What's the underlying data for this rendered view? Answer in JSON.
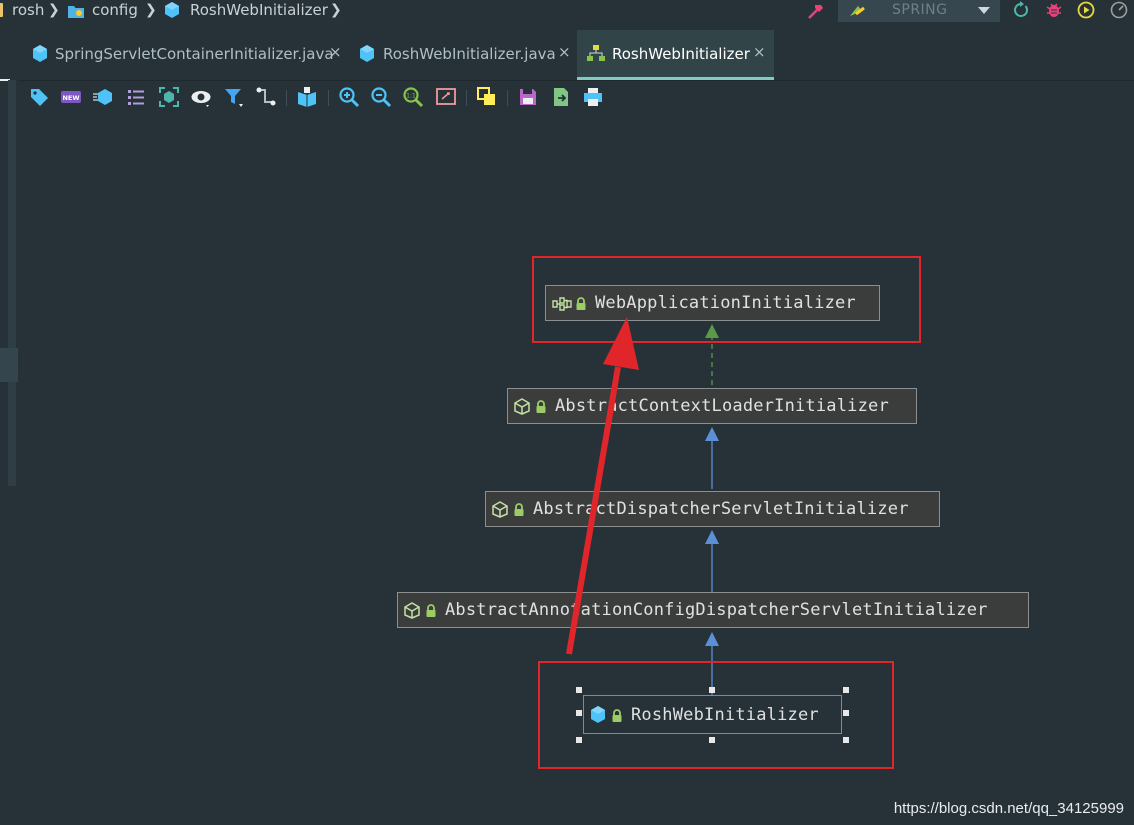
{
  "navbar": {
    "breadcrumbs": [
      {
        "label": "rosh",
        "icon": "module-icon"
      },
      {
        "label": "config",
        "icon": "package-icon"
      },
      {
        "label": "RoshWebInitializer",
        "icon": "class-icon"
      }
    ],
    "run_config": "SPRING",
    "actions": [
      "build-icon",
      "run-config-icon",
      "rerun-icon",
      "debug-icon",
      "coverage-icon",
      "profile-icon"
    ]
  },
  "tabs": [
    {
      "label": "SpringServletContainerInitializer.java",
      "icon": "java-class-icon",
      "active": false
    },
    {
      "label": "RoshWebInitializer.java",
      "icon": "java-class-icon",
      "active": false
    },
    {
      "label": "RoshWebInitializer",
      "icon": "diagram-icon",
      "active": true
    }
  ],
  "toolbar": {
    "buttons": [
      "tag-icon",
      "new-icon",
      "show-members-icon",
      "list-icon",
      "select-icon",
      "view-icon",
      "filter-icon",
      "route-icon",
      "book-icon",
      "zoom-in-icon",
      "zoom-out-icon",
      "actual-size-icon",
      "fit-content-icon",
      "layout-icon",
      "save-icon",
      "export-icon",
      "print-icon"
    ]
  },
  "diagram": {
    "nodes": [
      {
        "label": "WebApplicationInitializer",
        "kind": "interface"
      },
      {
        "label": "AbstractContextLoaderInitializer",
        "kind": "abstract-class"
      },
      {
        "label": "AbstractDispatcherServletInitializer",
        "kind": "abstract-class"
      },
      {
        "label": "AbstractAnnotationConfigDispatcherServletInitializer",
        "kind": "abstract-class"
      },
      {
        "label": "RoshWebInitializer",
        "kind": "class",
        "selected": true
      }
    ],
    "edges": [
      {
        "from": "RoshWebInitializer",
        "to": "AbstractAnnotationConfigDispatcherServletInitializer",
        "type": "extends"
      },
      {
        "from": "AbstractAnnotationConfigDispatcherServletInitializer",
        "to": "AbstractDispatcherServletInitializer",
        "type": "extends"
      },
      {
        "from": "AbstractDispatcherServletInitializer",
        "to": "AbstractContextLoaderInitializer",
        "type": "extends"
      },
      {
        "from": "AbstractContextLoaderInitializer",
        "to": "WebApplicationInitializer",
        "type": "implements"
      }
    ]
  },
  "colors": {
    "background": "#263238",
    "accent": "#80cbc4",
    "extends_edge": "#5b8fd6",
    "implements_edge": "#5a9a48",
    "annotation": "#e0262b"
  },
  "watermark": "https://blog.csdn.net/qq_34125999"
}
